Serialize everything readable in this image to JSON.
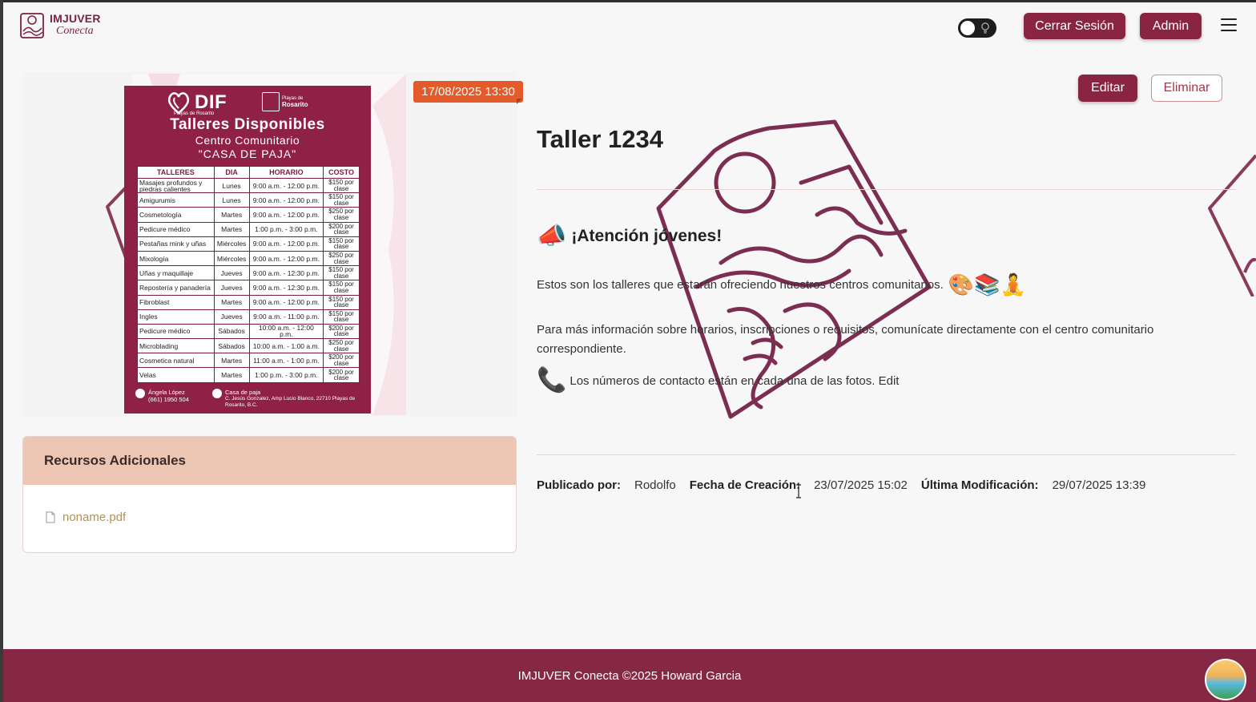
{
  "header": {
    "logo_title": "IMJUVER",
    "logo_subtitle": "Conecta",
    "logout_label": "Cerrar Sesión",
    "admin_label": "Admin"
  },
  "post": {
    "date_badge": "17/08/2025 13:30",
    "edit_label": "Editar",
    "delete_label": "Eliminar",
    "title": "Taller 1234",
    "attention_heading": "¡Atención jóvenes!",
    "paragraph1": "Estos son los talleres que estarán ofreciendo nuestros centros comunitarios.",
    "paragraph1_emojis": "🎨📚🧘",
    "paragraph2": "Para más información sobre horarios, inscripciones o requisitos, comunícate directamente con el centro comunitario correspondiente.",
    "paragraph3": "Los números de contacto están en cada una de las fotos. Edit"
  },
  "meta": {
    "published_by_label": "Publicado por:",
    "published_by_value": "Rodolfo",
    "created_label": "Fecha de Creación:",
    "created_value": "23/07/2025 15:02",
    "modified_label": "Última Modificación:",
    "modified_value": "29/07/2025 13:39"
  },
  "resources": {
    "heading": "Recursos Adicionales",
    "files": [
      "noname.pdf"
    ]
  },
  "poster": {
    "dif": "DIF",
    "dif_small": "Playas de Rosarito",
    "rosarito_small": "Playas de",
    "rosarito_big": "Rosarito",
    "title": "Talleres Disponibles",
    "subtitle": "Centro Comunitario",
    "subtitle2": "\"CASA DE PAJA\"",
    "headers": [
      "TALLERES",
      "DIA",
      "HORARIO",
      "COSTO"
    ],
    "rows": [
      [
        "Masajes profundos y piedras calientes",
        "Lunes",
        "9:00 a.m. - 12:00 p.m.",
        "$150 por clase"
      ],
      [
        "Amigurumis",
        "Lunes",
        "9:00 a.m. - 12:00 p.m.",
        "$150 por clase"
      ],
      [
        "Cosmetología",
        "Martes",
        "9:00 a.m. - 12:00 p.m.",
        "$250 por clase"
      ],
      [
        "Pedicure médico",
        "Martes",
        "1:00 p.m. - 3:00 p.m.",
        "$200 por clase"
      ],
      [
        "Pestañas mink y uñas",
        "Miércoles",
        "9:00 a.m. - 12:00 p.m.",
        "$150 por clase"
      ],
      [
        "Mixología",
        "Miércoles",
        "9:00 a.m. - 12:00 p.m.",
        "$250 por clase"
      ],
      [
        "Uñas y maquillaje",
        "Jueves",
        "9:00 a.m. - 12:30 p.m.",
        "$150 por clase"
      ],
      [
        "Repostería y panadería",
        "Jueves",
        "9:00 a.m. - 12:30 p.m.",
        "$150 por clase"
      ],
      [
        "Fibroblast",
        "Martes",
        "9:00 a.m. - 12:00 p.m.",
        "$150 por clase"
      ],
      [
        "Ingles",
        "Jueves",
        "9:00 a.m. - 11:00 p.m.",
        "$150 por clase"
      ],
      [
        "Pedicure médico",
        "Sábados",
        "10:00 a.m. - 12:00 p.m.",
        "$200 por clase"
      ],
      [
        "Microblading",
        "Sábados",
        "10:00 a.m. - 1:00 a.m.",
        "$250 por clase"
      ],
      [
        "Cosmetica natural",
        "Martes",
        "11:00 a.m. - 1:00 p.m.",
        "$200 por clase"
      ],
      [
        "Velas",
        "Martes",
        "1:00 p.m. - 3:00 p.m.",
        "$200 por clase"
      ]
    ],
    "contact_name": "Ángela López",
    "contact_phone": "(661) 1950 504",
    "place_name": "Casa de paja",
    "place_address": "C. Jesús Gonzalez, Amp Lucio Blanco, 22710 Playas de Rosarito, B.C."
  },
  "footer": {
    "text": "IMJUVER Conecta ©2025 Howard Garcia"
  },
  "colors": {
    "brand": "#8a2443",
    "badge": "#e35a2b",
    "resources_header": "#ecc6b3",
    "footer": "#862843"
  },
  "icons": [
    "logo-icon",
    "theme-toggle-icon",
    "menu-icon",
    "megaphone-icon",
    "phone-icon",
    "file-icon",
    "avatar-beach-icon"
  ]
}
